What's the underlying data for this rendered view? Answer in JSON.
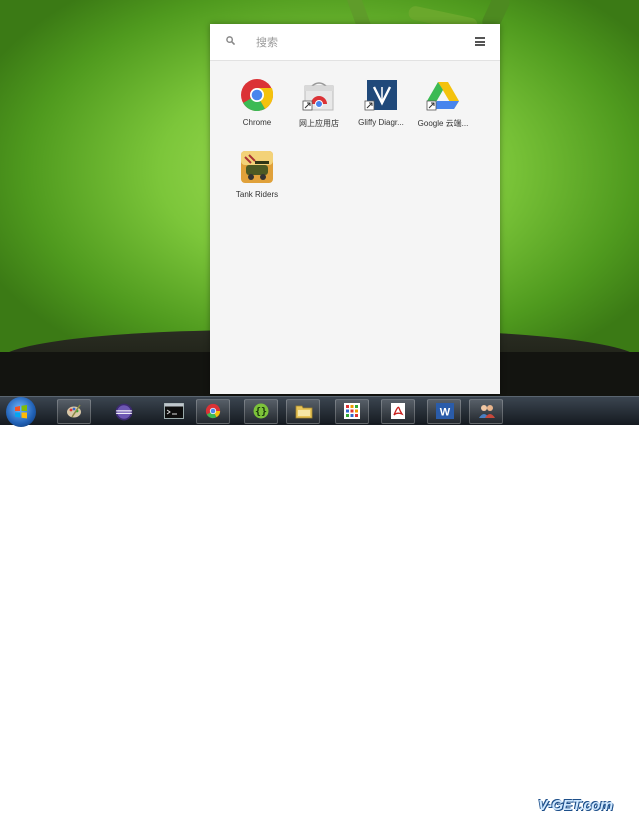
{
  "launcher": {
    "search_placeholder": "搜索",
    "apps": [
      {
        "label": "Chrome",
        "icon": "chrome-icon"
      },
      {
        "label": "网上应用店",
        "icon": "web-store-icon"
      },
      {
        "label": "Gliffy Diagr...",
        "icon": "gliffy-icon"
      },
      {
        "label": "Google 云端...",
        "icon": "google-drive-icon"
      },
      {
        "label": "Tank Riders",
        "icon": "tank-riders-icon"
      }
    ]
  },
  "taskbar": {
    "items": [
      "start-orb",
      "paint-app",
      "eclipse-app",
      "terminal-app",
      "chrome-app",
      "code-app",
      "file-explorer-app",
      "apps-grid-app",
      "pdf-app",
      "word-app",
      "contacts-app"
    ]
  },
  "watermark": "V-GET.com",
  "colors": {
    "desktop_green": "#7cc63a",
    "panel": "#f5f5f5",
    "taskbar": "#1c232b"
  }
}
